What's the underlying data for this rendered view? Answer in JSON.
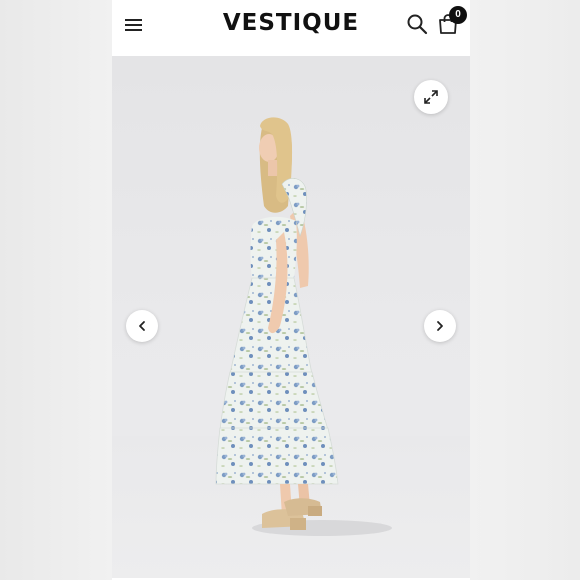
{
  "header": {
    "brand": "VESTIQUE",
    "menu_icon": "hamburger-menu-icon",
    "search_icon": "search-icon",
    "cart_icon": "shopping-bag-icon",
    "cart_count": "0"
  },
  "gallery": {
    "expand_icon": "expand-icon",
    "prev_icon": "chevron-left-icon",
    "next_icon": "chevron-right-icon"
  },
  "colors": {
    "header_bg": "#ffffff",
    "badge_bg": "#111111",
    "dress_base": "#eef2f0",
    "floral_blue": "#7d9cc4",
    "floral_green": "#b9c9a6"
  }
}
